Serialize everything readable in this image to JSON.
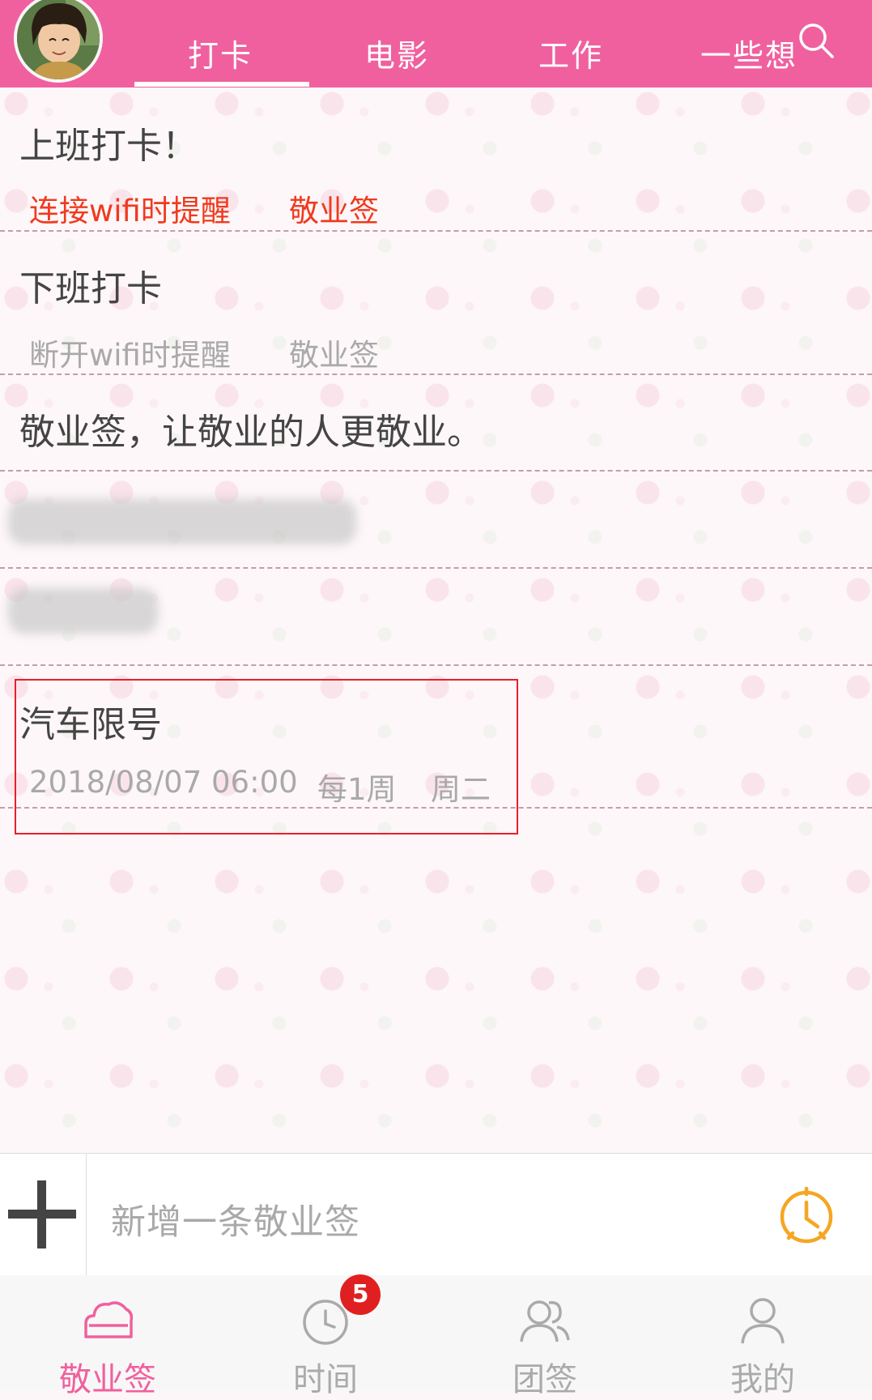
{
  "header": {
    "tabs": [
      {
        "label": "打卡"
      },
      {
        "label": "电影"
      },
      {
        "label": "工作"
      },
      {
        "label": "一些想"
      }
    ],
    "active_tab": "打卡",
    "search_icon": "search-icon",
    "avatar_icon": "avatar"
  },
  "list": {
    "items": [
      {
        "title": "上班打卡！",
        "sub1": "连接wifi时提醒",
        "sub2": "敬业签"
      },
      {
        "title": "下班打卡",
        "sub1": "断开wifi时提醒",
        "sub2": "敬业签"
      },
      {
        "title": "敬业签，让敬业的人更敬业。"
      },
      {
        "title": "",
        "redacted": true
      },
      {
        "title": "",
        "redacted": true
      },
      {
        "title": "汽车限号",
        "sub1": "2018/08/07 06:00",
        "sub2": "每1周",
        "sub3": "周二"
      }
    ]
  },
  "input_bar": {
    "placeholder": "新增一条敬业签",
    "add_icon": "plus-icon",
    "clock_icon": "clock-icon"
  },
  "bottom_nav": {
    "items": [
      {
        "label": "敬业签",
        "icon": "cloud-icon",
        "active": true
      },
      {
        "label": "时间",
        "icon": "clock-icon",
        "badge": "5"
      },
      {
        "label": "团签",
        "icon": "group-icon"
      },
      {
        "label": "我的",
        "icon": "person-icon"
      }
    ]
  },
  "colors": {
    "header": "#f0609e",
    "accent_red": "#f03a1e",
    "active_nav": "#f0609e",
    "clock_orange": "#f5a623",
    "badge": "#e02020"
  }
}
